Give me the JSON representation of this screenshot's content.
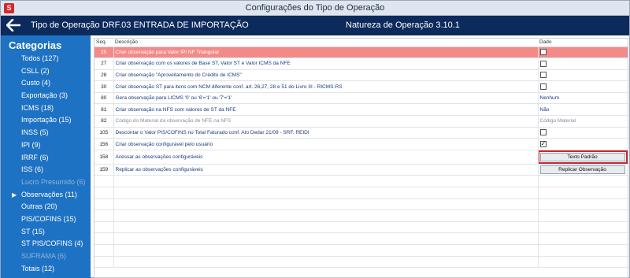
{
  "window": {
    "title": "Configurações do Tipo de Operação"
  },
  "header": {
    "op_prefix": "Tipo de Operação DRF.03",
    "op_name": "ENTRADA DE IMPORTAÇÃO",
    "nature": "Natureza de Operação 3.10.1"
  },
  "sidebar": {
    "title": "Categorias",
    "items": [
      {
        "label": "Todos (127)",
        "disabled": false
      },
      {
        "label": "CSLL (2)",
        "disabled": false
      },
      {
        "label": "Custo (4)",
        "disabled": false
      },
      {
        "label": "Exportação (3)",
        "disabled": false
      },
      {
        "label": "ICMS (18)",
        "disabled": false
      },
      {
        "label": "Importação (15)",
        "disabled": false
      },
      {
        "label": "INSS (5)",
        "disabled": false
      },
      {
        "label": "IPI (9)",
        "disabled": false
      },
      {
        "label": "IRRF (6)",
        "disabled": false
      },
      {
        "label": "ISS (6)",
        "disabled": false
      },
      {
        "label": "Lucro Presumido (6)",
        "disabled": true
      },
      {
        "label": "Observações (11)",
        "disabled": false,
        "active": true
      },
      {
        "label": "Outras (20)",
        "disabled": false
      },
      {
        "label": "PIS/COFINS (15)",
        "disabled": false
      },
      {
        "label": "ST (15)",
        "disabled": false
      },
      {
        "label": "ST PIS/COFINS (4)",
        "disabled": false
      },
      {
        "label": "SUFRAMA (6)",
        "disabled": true
      },
      {
        "label": "Totais (12)",
        "disabled": false
      }
    ]
  },
  "table": {
    "columns": {
      "seq": "Seq.",
      "desc": "Descrição",
      "dado": "Dado"
    },
    "rows": [
      {
        "seq": "25",
        "desc": "Criar observação para Valor IPI NF Triangular",
        "dado_type": "checkbox",
        "checked": false,
        "selected": true
      },
      {
        "seq": "27",
        "desc": "Criar observação com os valores de Base ST, Valor ST e Valor ICMS da NFE",
        "dado_type": "checkbox",
        "checked": false
      },
      {
        "seq": "28",
        "desc": "Criar observação \"Aproveitamento do Crédito de ICMS\"",
        "dado_type": "checkbox",
        "checked": false
      },
      {
        "seq": "30",
        "desc": "Criar observação ST para itens com NCM diferente conf. art. 26,27, 28 e 51 do Livro III - RICMS-RS",
        "dado_type": "checkbox",
        "checked": false
      },
      {
        "seq": "80",
        "desc": "Gera observação para LICMS '0' ou '6'='1' ou '7'='1'",
        "dado_type": "text",
        "value": "Nenhum"
      },
      {
        "seq": "81",
        "desc": "Criar observação na NFS com valores de ST da NFE",
        "dado_type": "text",
        "value": "Não"
      },
      {
        "seq": "82",
        "desc": "Código do Material da observação de NFE na NFS",
        "dado_type": "text",
        "value": "Código Material",
        "grey": true
      },
      {
        "seq": "105",
        "desc": "Descontar o Valor PIS/COFINS no Total Faturado conf. Ato Dedar 21/09 - SRF. REIDI",
        "dado_type": "checkbox",
        "checked": false
      },
      {
        "seq": "156",
        "desc": "Criar observação configurável pelo usuário",
        "dado_type": "checkbox",
        "checked": true
      },
      {
        "seq": "158",
        "desc": "Acessar as observações configuráveis",
        "dado_type": "button",
        "value": "Texto Padrão",
        "highlight": true
      },
      {
        "seq": "159",
        "desc": "Replicar as observações configuráveis",
        "dado_type": "button",
        "value": "Replicar Observação"
      }
    ]
  }
}
